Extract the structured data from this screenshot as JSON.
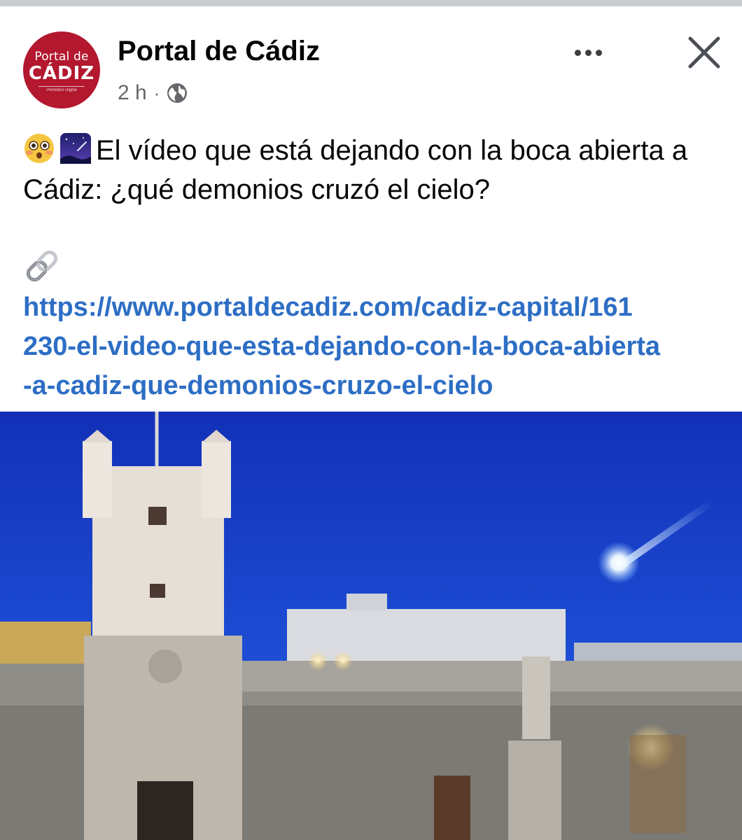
{
  "post": {
    "page_name": "Portal de Cádiz",
    "timestamp": "2 h",
    "separator": "·",
    "audience_icon": "globe-icon",
    "text": "El vídeo que está dejando con la boca abierta a Cádiz: ¿qué demonios cruzó el cielo?",
    "emojis": [
      "flushed-face",
      "night-sky-shooting-star"
    ],
    "link_icon": "link-icon",
    "link": "https://www.portaldecadiz.com/cadiz-capital/161\n230-el-video-que-esta-dejando-con-la-boca-abierta\n-a-cadiz-que-demonios-cruzo-el-cielo"
  },
  "avatar": {
    "line1": "Portal de",
    "line2": "CÁDIZ",
    "line3": "Periódico Digital"
  },
  "header_actions": {
    "more_icon": "more-horizontal-icon",
    "close_icon": "close-icon"
  },
  "colors": {
    "brand": "#b3182f",
    "link": "#2d6ec5",
    "secondary_text": "#65676b",
    "sky": "#1a3fbf"
  }
}
